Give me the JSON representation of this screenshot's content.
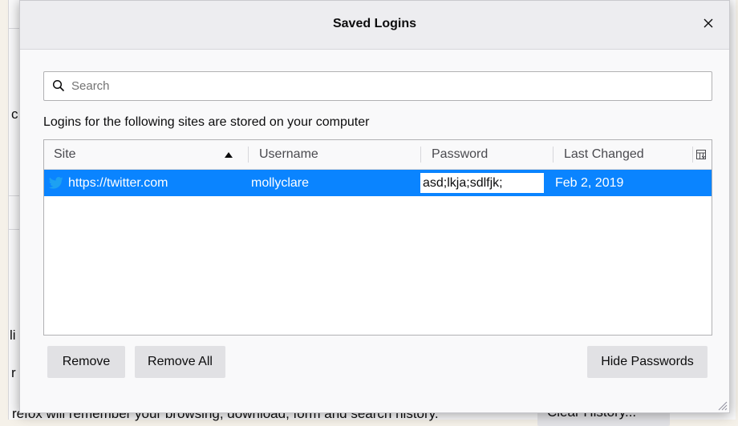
{
  "background": {
    "sidebar_letters": [
      "c",
      "li",
      "r"
    ],
    "footer_text": "refox will remember your browsing, download, form and search history.",
    "clear_history_label": "Clear History..."
  },
  "dialog": {
    "title": "Saved Logins",
    "close_icon": "close-icon",
    "search": {
      "placeholder": "Search",
      "value": ""
    },
    "intro": "Logins for the following sites are stored on your computer",
    "table": {
      "columns": [
        {
          "label": "Site",
          "sorted": "ascending"
        },
        {
          "label": "Username"
        },
        {
          "label": "Password"
        },
        {
          "label": "Last Changed"
        }
      ],
      "rows": [
        {
          "site": "https://twitter.com",
          "site_icon": "twitter-icon",
          "username": "mollyclare",
          "password": "asd;lkja;sdlfjk;",
          "last_changed": "Feb 2, 2019",
          "selected": true
        }
      ]
    },
    "buttons": {
      "remove": "Remove",
      "remove_all": "Remove All",
      "hide_passwords": "Hide Passwords"
    }
  },
  "colors": {
    "selection": "#0a84ff",
    "twitter": "#1da1f2",
    "button_bg": "#e1e1e4"
  }
}
